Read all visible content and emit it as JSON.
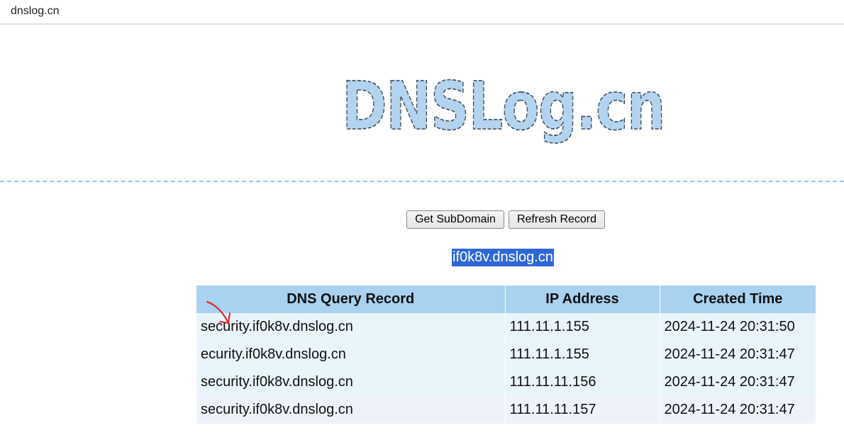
{
  "window": {
    "title": "dnslog.cn"
  },
  "logo": {
    "text": "DNSLog.cn",
    "icon": "dnslog-logo",
    "fill_color": "#b3d3ee",
    "outline_color": "#3a4a5c"
  },
  "toolbar": {
    "get_subdomain_label": "Get SubDomain",
    "refresh_record_label": "Refresh Record"
  },
  "subdomain": {
    "value": "if0k8v.dnslog.cn",
    "highlight_color": "#2f67d8"
  },
  "records_table": {
    "columns": [
      "DNS Query Record",
      "IP Address",
      "Created Time"
    ],
    "rows": [
      [
        "security.if0k8v.dnslog.cn",
        "111.11.1.155",
        "2024-11-24 20:31:50"
      ],
      [
        "ecurity.if0k8v.dnslog.cn",
        "111.11.1.155",
        "2024-11-24 20:31:47"
      ],
      [
        "security.if0k8v.dnslog.cn",
        "111.11.11.156",
        "2024-11-24 20:31:47"
      ],
      [
        "security.if0k8v.dnslog.cn",
        "111.11.11.157",
        "2024-11-24 20:31:47"
      ]
    ],
    "header_color": "#a9d1f0",
    "row_color": "#eaf4fb"
  },
  "annotation": {
    "icon": "red-arrow-annotation-icon",
    "color": "#e02020"
  }
}
